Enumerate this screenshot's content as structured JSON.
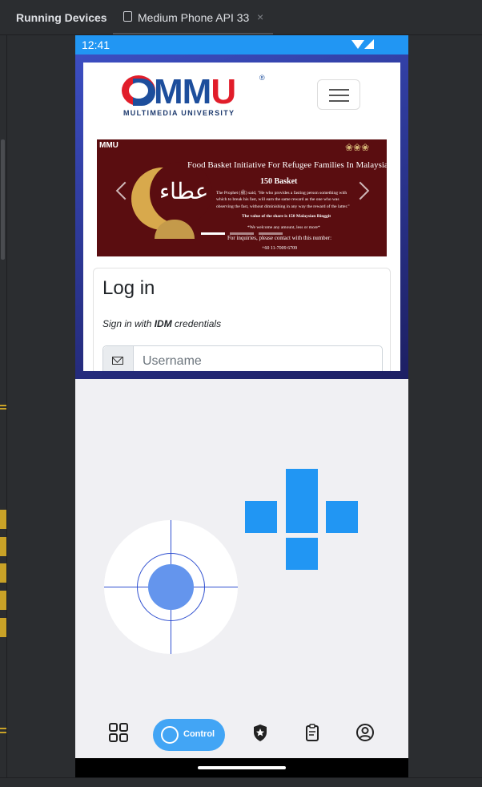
{
  "ide": {
    "panel_title": "Running Devices",
    "device_tab": "Medium Phone API 33",
    "tab_close": "×"
  },
  "status_bar": {
    "time": "12:41"
  },
  "website": {
    "logo_text_main": "MM",
    "logo_text_accent": "U",
    "logo_registered": "®",
    "logo_subtitle": "MULTIMEDIA UNIVERSITY",
    "banner": {
      "corner_logo": "MMU",
      "arabic_text": "عطاء",
      "headline": "Food Basket Initiative For Refugee Families In Malaysia",
      "basket_count": "150 Basket",
      "hadith_line1": "The Prophet (ﷺ) said, \"He who provides a fasting person something with",
      "hadith_line2": "which to break his fast, will earn the same reward as the one who was",
      "hadith_line3": "observing the fast, without diminishing in any way the reward of the latter.\"",
      "share_value": "The value of the share is 150 Malaysian Ringgit",
      "welcome": "*We welcome any amount, less or more*",
      "inquiry": "For inquiries, please contact with this number:",
      "phone": "+60 11-7009 6709"
    },
    "login": {
      "title": "Log in",
      "subtitle_prefix": "Sign in with ",
      "subtitle_bold": "IDM",
      "subtitle_suffix": " credentials",
      "username_placeholder": "Username"
    }
  },
  "bottom_nav": {
    "active_label": "Control",
    "items": [
      "grid-icon",
      "control-dial-icon",
      "shield-star-icon",
      "clipboard-icon",
      "account-icon"
    ]
  },
  "colors": {
    "status_bar": "#2196f3",
    "dpad": "#2196f3",
    "joystick_knob": "#6495ed",
    "nav_active": "#42a5f5",
    "logo_blue": "#1d4e9c",
    "logo_red": "#e11d2a",
    "banner_bg": "#5a0d10"
  }
}
